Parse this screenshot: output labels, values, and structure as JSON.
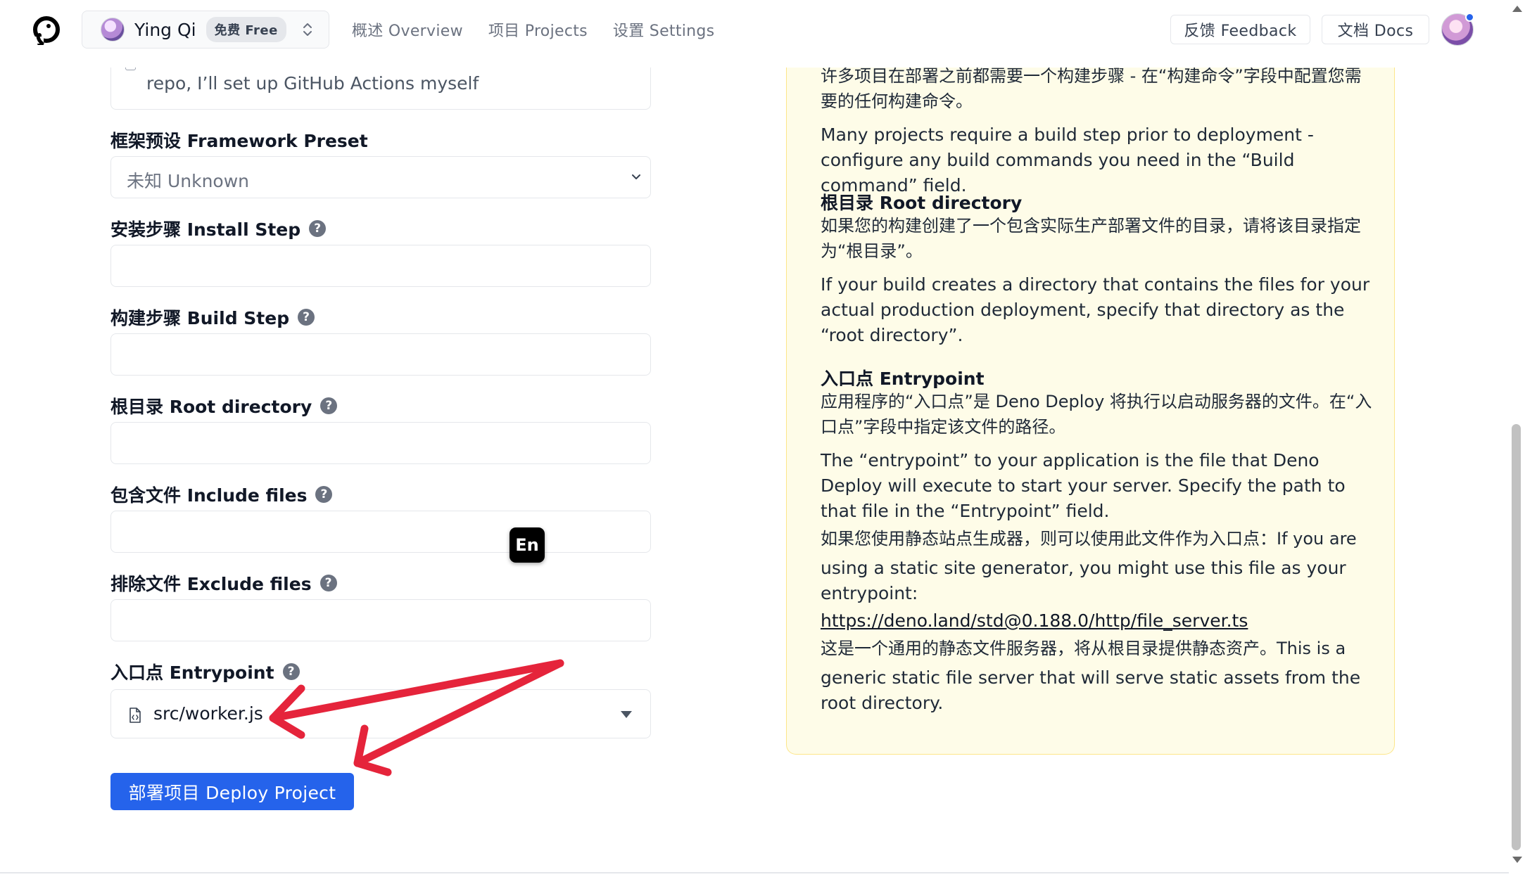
{
  "nav": {
    "account_name": "Ying Qi",
    "plan_badge": "免费 Free",
    "links": [
      "概述 Overview",
      "项目 Projects",
      "设置 Settings"
    ],
    "feedback": "反馈 Feedback",
    "docs": "文档 Docs"
  },
  "form": {
    "checkbox_label": "repo, I’ll set up GitHub Actions myself",
    "framework_label": "框架预设 Framework Preset",
    "framework_value": "未知 Unknown",
    "install_label": "安装步骤 Install Step",
    "build_label": "构建步骤 Build Step",
    "root_label": "根目录 Root directory",
    "include_label": "包含文件 Include files",
    "exclude_label": "排除文件 Exclude files",
    "entry_label": "入口点 Entrypoint",
    "entry_value": "src/worker.js",
    "deploy_button": "部署项目 Deploy Project",
    "help_glyph": "?"
  },
  "ime": {
    "label": "En"
  },
  "help": {
    "build_zh": "许多项目在部署之前都需要一个构建步骤 - 在“构建命令”字段中配置您需要的任何构建命令。",
    "build_en": "Many projects require a build step prior to deployment - configure any build commands you need in the “Build command” field.",
    "root_heading": "根目录 Root directory",
    "root_zh": "如果您的构建创建了一个包含实际生产部署文件的目录，请将该目录指定为“根目录”。",
    "root_en": "If your build creates a directory that contains the files for your actual production deployment, specify that directory as the “root directory”.",
    "entry_heading": "入口点 Entrypoint",
    "entry_zh": "应用程序的“入口点”是 Deno Deploy 将执行以启动服务器的文件。在“入口点”字段中指定该文件的路径。",
    "entry_en": "The “entrypoint” to your application is the file that Deno Deploy will execute to start your server. Specify the path to that file in the “Entrypoint” field.",
    "static_line1": "如果您使用静态站点生成器，则可以使用此文件作为入口点：If you are",
    "static_line2": "using a static site generator, you might use this file as your entrypoint:",
    "link": "https://deno.land/std@0.188.0/http/file_server.ts",
    "generic_line1": "这是一个通用的静态文件服务器，将从根目录提供静态资产。This is a",
    "generic_line2": "generic static file server that will serve static assets from the root directory."
  },
  "colors": {
    "primary": "#2563eb",
    "help_bg": "#fefce8",
    "help_border": "#fde68a",
    "annotation_arrow": "#e5243b"
  }
}
